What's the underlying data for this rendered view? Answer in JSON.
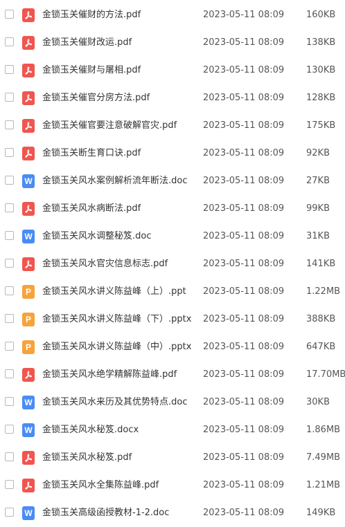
{
  "colors": {
    "pdf": "#f0554f",
    "doc": "#4a8cf2",
    "ppt": "#f7a33c"
  },
  "icons": {
    "pdf": "pdf-file-icon",
    "doc": "word-file-icon",
    "ppt": "powerpoint-file-icon"
  },
  "icon_letters": {
    "doc": "W",
    "ppt": "P"
  },
  "files": [
    {
      "name": "金锁玉关催财的方法.pdf",
      "type": "pdf",
      "date": "2023-05-11 08:09",
      "size": "160KB"
    },
    {
      "name": "金锁玉关催财改运.pdf",
      "type": "pdf",
      "date": "2023-05-11 08:09",
      "size": "138KB"
    },
    {
      "name": "金锁玉关催财与屠相.pdf",
      "type": "pdf",
      "date": "2023-05-11 08:09",
      "size": "130KB"
    },
    {
      "name": "金锁玉关催官分房方法.pdf",
      "type": "pdf",
      "date": "2023-05-11 08:09",
      "size": "128KB"
    },
    {
      "name": "金锁玉关催官要注意破解官灾.pdf",
      "type": "pdf",
      "date": "2023-05-11 08:09",
      "size": "175KB"
    },
    {
      "name": "金锁玉关断生育口诀.pdf",
      "type": "pdf",
      "date": "2023-05-11 08:09",
      "size": "92KB"
    },
    {
      "name": "金锁玉关风水案例解析流年断法.doc",
      "type": "doc",
      "date": "2023-05-11 08:09",
      "size": "27KB"
    },
    {
      "name": "金锁玉关风水病断法.pdf",
      "type": "pdf",
      "date": "2023-05-11 08:09",
      "size": "99KB"
    },
    {
      "name": "金锁玉关风水调整秘笈.doc",
      "type": "doc",
      "date": "2023-05-11 08:09",
      "size": "31KB"
    },
    {
      "name": "金锁玉关风水官灾信息标志.pdf",
      "type": "pdf",
      "date": "2023-05-11 08:09",
      "size": "141KB"
    },
    {
      "name": "金锁玉关风水讲义陈益峰（上）.ppt",
      "type": "ppt",
      "date": "2023-05-11 08:09",
      "size": "1.22MB"
    },
    {
      "name": "金锁玉关风水讲义陈益峰（下）.pptx",
      "type": "ppt",
      "date": "2023-05-11 08:09",
      "size": "388KB"
    },
    {
      "name": "金锁玉关风水讲义陈益峰（中）.pptx",
      "type": "ppt",
      "date": "2023-05-11 08:09",
      "size": "647KB"
    },
    {
      "name": "金锁玉关风水绝学精解陈益峰.pdf",
      "type": "pdf",
      "date": "2023-05-11 08:09",
      "size": "17.70MB"
    },
    {
      "name": "金锁玉关风水来历及其优势特点.doc",
      "type": "doc",
      "date": "2023-05-11 08:09",
      "size": "30KB"
    },
    {
      "name": "金锁玉关风水秘笈.docx",
      "type": "doc",
      "date": "2023-05-11 08:09",
      "size": "1.86MB"
    },
    {
      "name": "金锁玉关风水秘笈.pdf",
      "type": "pdf",
      "date": "2023-05-11 08:09",
      "size": "7.49MB"
    },
    {
      "name": "金锁玉关风水全集陈益峰.pdf",
      "type": "pdf",
      "date": "2023-05-11 08:09",
      "size": "1.21MB"
    },
    {
      "name": "金锁玉关高级函授教材-1-2.doc",
      "type": "doc",
      "date": "2023-05-11 08:09",
      "size": "149KB"
    }
  ]
}
